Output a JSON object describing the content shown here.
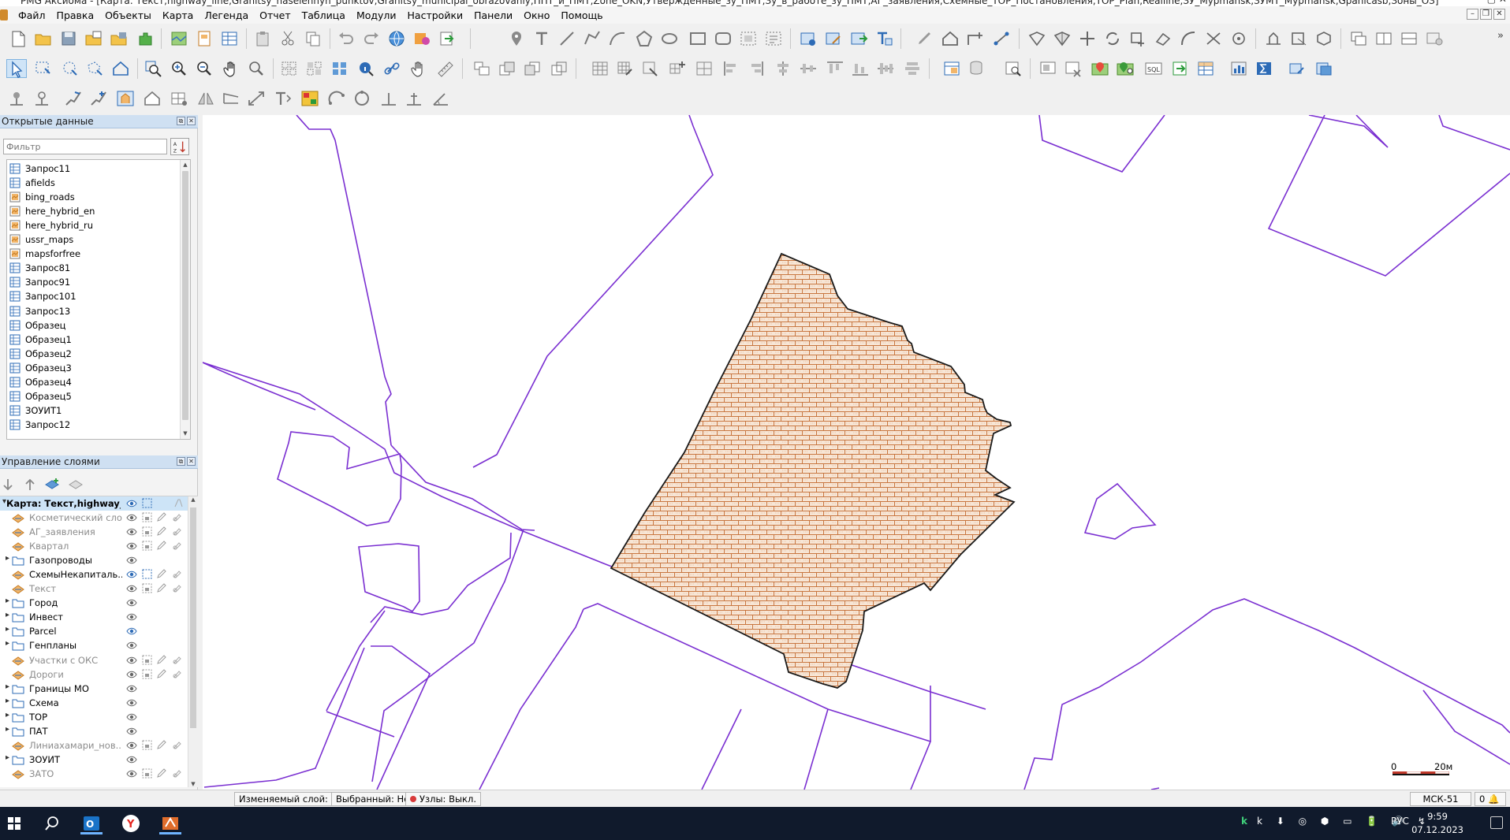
{
  "window": {
    "title": "PMG Аксиома - [Карта: Текст,highway_line,Granitsy_naselennyh_punktov,Granitsy_municipal_obrazovaniy,ППТ_и_ПМТ,Zone_OKN,Утвержденные_зу_ПМТ,Зу_в_работе_зу_ПМТ,АГ_заявления,Схемные_ТОР_Постановления,TOP_Plan,Realline,ЗУ_Mypmansk,ЗУМТ_Mypmansk,Gpanicasb,Зоны_ОЗ]",
    "controls": "— ▢ ✕"
  },
  "menu": [
    "Файл",
    "Правка",
    "Объекты",
    "Карта",
    "Легенда",
    "Отчет",
    "Таблица",
    "Модули",
    "Настройки",
    "Панели",
    "Окно",
    "Помощь"
  ],
  "mdi_controls": [
    "–",
    "❐",
    "✕"
  ],
  "open_data_panel": {
    "title": "Открытые данные",
    "filter_placeholder": "Фильтр",
    "items": [
      {
        "label": "Запрос11",
        "icon": "table-icon"
      },
      {
        "label": "afields",
        "icon": "table-icon"
      },
      {
        "label": "bing_roads",
        "icon": "raster-icon"
      },
      {
        "label": "here_hybrid_en",
        "icon": "raster-icon"
      },
      {
        "label": "here_hybrid_ru",
        "icon": "raster-icon"
      },
      {
        "label": "ussr_maps",
        "icon": "raster-icon"
      },
      {
        "label": "mapsforfree",
        "icon": "raster-icon"
      },
      {
        "label": "Запрос81",
        "icon": "table-icon"
      },
      {
        "label": "Запрос91",
        "icon": "table-icon"
      },
      {
        "label": "Запрос101",
        "icon": "table-icon"
      },
      {
        "label": "Запрос13",
        "icon": "table-icon"
      },
      {
        "label": "Образец",
        "icon": "table-icon"
      },
      {
        "label": "Образец1",
        "icon": "table-icon"
      },
      {
        "label": "Образец2",
        "icon": "table-icon"
      },
      {
        "label": "Образец3",
        "icon": "table-icon"
      },
      {
        "label": "Образец4",
        "icon": "table-icon"
      },
      {
        "label": "Образец5",
        "icon": "table-icon"
      },
      {
        "label": "ЗОУИТ1",
        "icon": "table-icon"
      },
      {
        "label": "Запрос12",
        "icon": "table-icon"
      }
    ]
  },
  "layer_panel": {
    "title": "Управление слоями",
    "map_node": "Карта: Текст,highway_li...",
    "layers": [
      {
        "name": "Косметический слой",
        "kind": "layer",
        "muted": true,
        "controls": true
      },
      {
        "name": "АГ_заявления",
        "kind": "layer",
        "muted": true,
        "controls": true
      },
      {
        "name": "Квартал",
        "kind": "layer",
        "muted": true,
        "controls": true
      },
      {
        "name": "Газопроводы",
        "kind": "group",
        "muted": false,
        "controls": false
      },
      {
        "name": "СхемыНекапиталь...",
        "kind": "layer",
        "muted": false,
        "controls": true,
        "selectable": true
      },
      {
        "name": "Текст",
        "kind": "layer",
        "muted": true,
        "controls": true
      },
      {
        "name": "Город",
        "kind": "group",
        "muted": false,
        "controls": false
      },
      {
        "name": "Инвест",
        "kind": "group",
        "muted": false,
        "controls": false
      },
      {
        "name": "Parcel",
        "kind": "group",
        "muted": false,
        "controls": false,
        "visible_blue": true
      },
      {
        "name": "Генпланы",
        "kind": "group",
        "muted": false,
        "controls": false
      },
      {
        "name": "Участки с ОКС",
        "kind": "layer",
        "muted": true,
        "controls": true
      },
      {
        "name": "Дороги",
        "kind": "layer",
        "muted": true,
        "controls": true
      },
      {
        "name": "Границы МО",
        "kind": "group",
        "muted": false,
        "controls": false
      },
      {
        "name": "Схема",
        "kind": "group",
        "muted": false,
        "controls": false
      },
      {
        "name": "ТОР",
        "kind": "group",
        "muted": false,
        "controls": false
      },
      {
        "name": "ПАТ",
        "kind": "group",
        "muted": false,
        "controls": false
      },
      {
        "name": "Линиахамари_нов...",
        "kind": "layer",
        "muted": true,
        "controls": true
      },
      {
        "name": "ЗОУИТ",
        "kind": "group",
        "muted": false,
        "controls": false
      },
      {
        "name": "ЗАТО",
        "kind": "layer",
        "muted": true,
        "controls": true
      }
    ]
  },
  "map": {
    "scale_zero": "0",
    "scale_label": "20м",
    "colors": {
      "boundary": "#7a2fd1",
      "hatch_fill": "#f6e3d2",
      "hatch_line": "#c8753e",
      "outline": "#1a1a1a"
    }
  },
  "statusbar": {
    "editable_layer": "Изменяемый слой: Нет",
    "selected_layer": "Выбранный: Нет",
    "nodes": "Узлы: Выкл.",
    "projection": "МСК-51",
    "count": "0"
  },
  "taskbar": {
    "tray_lang": "РУС",
    "time": "9:59",
    "date": "07.12.2023",
    "tray_icons": "k ⬇ ◎ ⬢ ▭ 🔋 🔊 ↯"
  }
}
